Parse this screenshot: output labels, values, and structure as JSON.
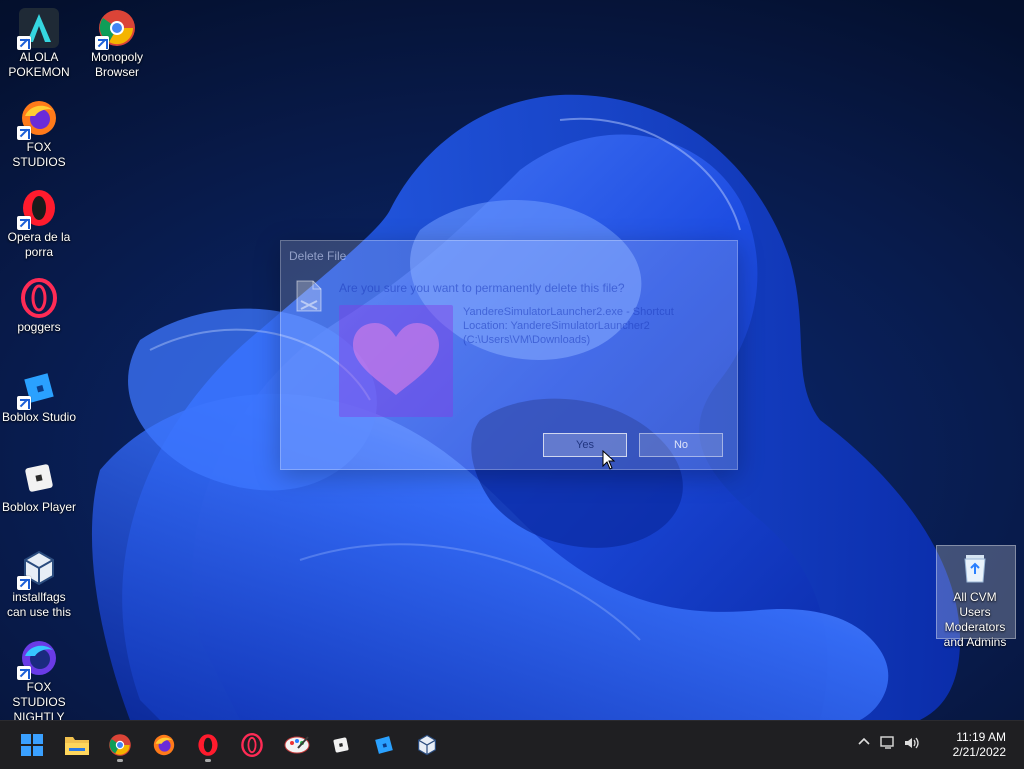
{
  "desktop": {
    "icons": [
      {
        "label": "ALOLA POKEMON"
      },
      {
        "label": "Monopoly Browser"
      },
      {
        "label": "FOX STUDIOS"
      },
      {
        "label": "Opera de la porra"
      },
      {
        "label": "poggers"
      },
      {
        "label": "Boblox Studio"
      },
      {
        "label": "Boblox Player"
      },
      {
        "label": "installfags can use this"
      },
      {
        "label": "FOX STUDIOS NIGHTLY"
      },
      {
        "label": "All CVM Users Moderators and Admins"
      }
    ]
  },
  "dialog": {
    "title": "Delete File",
    "question": "Are you sure you want to permanently delete this file?",
    "file_name": "YandereSimulatorLauncher2.exe - Shortcut",
    "location_label": "Location: YandereSimulatorLauncher2",
    "location_path": "(C:\\Users\\VM\\Downloads)",
    "yes_label": "Yes",
    "no_label": "No"
  },
  "taskbar": {
    "time": "11:19 AM",
    "date": "2/21/2022",
    "pinned": [
      "start-icon",
      "file-explorer-icon",
      "chrome-icon",
      "firefox-icon",
      "opera-icon",
      "opera-gx-icon",
      "paint-brush-icon",
      "roblox-player-icon",
      "roblox-studio-icon",
      "virtualbox-icon"
    ]
  },
  "colors": {
    "taskbar": "#1f1f22",
    "accent": "#1c5fd6"
  }
}
